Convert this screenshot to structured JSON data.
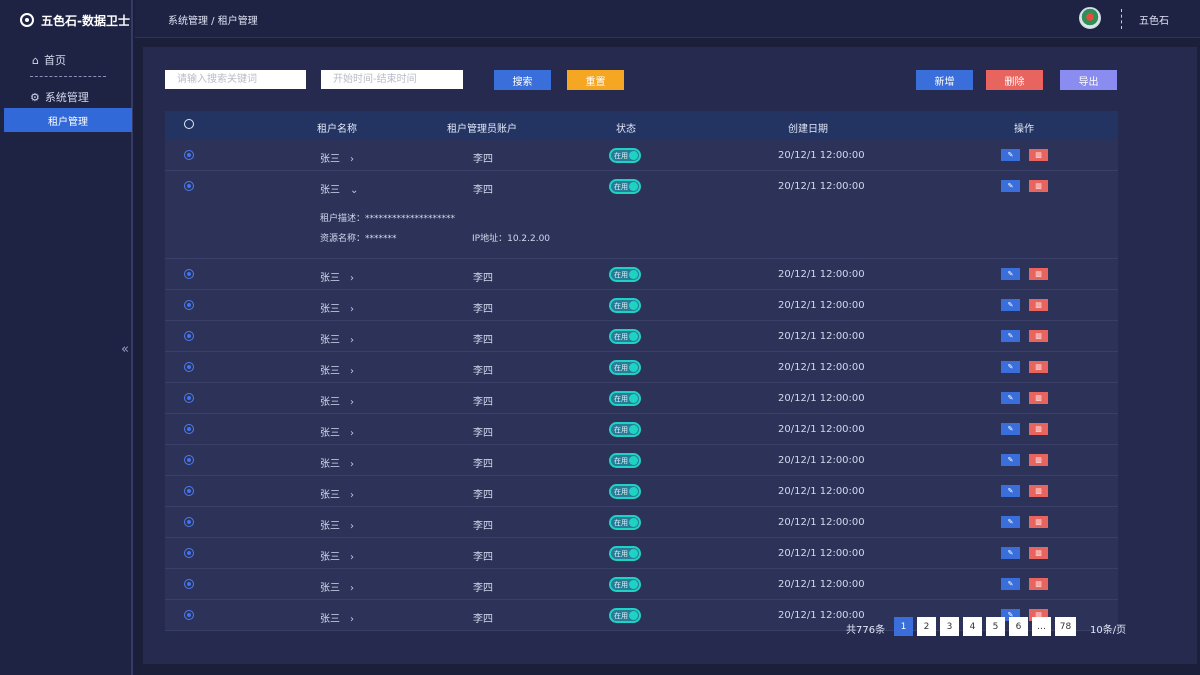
{
  "app": {
    "title": "五色石-数据卫士"
  },
  "sidebar": {
    "items": [
      {
        "label": "首页",
        "icon": "home-icon"
      },
      {
        "label": "系统管理",
        "icon": "gear-icon"
      },
      {
        "label": "租户管理",
        "active": true
      }
    ],
    "collapse_glyph": "«"
  },
  "header": {
    "breadcrumb": "系统管理 / 租户管理",
    "username": "五色石"
  },
  "toolbar": {
    "search_placeholder": "请输入搜索关键词",
    "date_placeholder": "开始时间-结束时间",
    "search_label": "搜索",
    "reset_label": "重置",
    "add_label": "新增",
    "delete_label": "删除",
    "export_label": "导出"
  },
  "table": {
    "headers": {
      "name": "租户名称",
      "admin": "租户管理员账户",
      "status": "状态",
      "date": "创建日期",
      "ops": "操作"
    },
    "status_label": "在用",
    "rows": [
      {
        "name": "张三",
        "admin": "李四",
        "date": "20/12/1 12:00:00",
        "chev": "›"
      },
      {
        "name": "张三",
        "admin": "李四",
        "date": "20/12/1 12:00:00",
        "chev": "⌄",
        "desc_label": "租户描述：",
        "desc_value": "********************",
        "resource_label": "资源名称：",
        "resource_value": "*******",
        "ip_label": "IP地址：",
        "ip_value": "10.2.2.00"
      },
      {
        "name": "张三",
        "admin": "李四",
        "date": "20/12/1 12:00:00",
        "chev": "›"
      },
      {
        "name": "张三",
        "admin": "李四",
        "date": "20/12/1 12:00:00",
        "chev": "›"
      },
      {
        "name": "张三",
        "admin": "李四",
        "date": "20/12/1 12:00:00",
        "chev": "›"
      },
      {
        "name": "张三",
        "admin": "李四",
        "date": "20/12/1 12:00:00",
        "chev": "›"
      },
      {
        "name": "张三",
        "admin": "李四",
        "date": "20/12/1 12:00:00",
        "chev": "›"
      },
      {
        "name": "张三",
        "admin": "李四",
        "date": "20/12/1 12:00:00",
        "chev": "›"
      },
      {
        "name": "张三",
        "admin": "李四",
        "date": "20/12/1 12:00:00",
        "chev": "›"
      },
      {
        "name": "张三",
        "admin": "李四",
        "date": "20/12/1 12:00:00",
        "chev": "›"
      },
      {
        "name": "张三",
        "admin": "李四",
        "date": "20/12/1 12:00:00",
        "chev": "›"
      },
      {
        "name": "张三",
        "admin": "李四",
        "date": "20/12/1 12:00:00",
        "chev": "›"
      },
      {
        "name": "张三",
        "admin": "李四",
        "date": "20/12/1 12:00:00",
        "chev": "›"
      },
      {
        "name": "张三",
        "admin": "李四",
        "date": "20/12/1 12:00:00",
        "chev": "›"
      }
    ]
  },
  "pagination": {
    "total": "共776条",
    "pages": [
      "1",
      "2",
      "3",
      "4",
      "5",
      "6",
      "…",
      "78"
    ],
    "active_page": "1",
    "per_page": "10条/页"
  },
  "colors": {
    "accent": "#3a6fdb",
    "warning": "#f5a623",
    "danger": "#e8645e",
    "export": "#8a8cf0",
    "toggle": "#1fd3c2"
  }
}
